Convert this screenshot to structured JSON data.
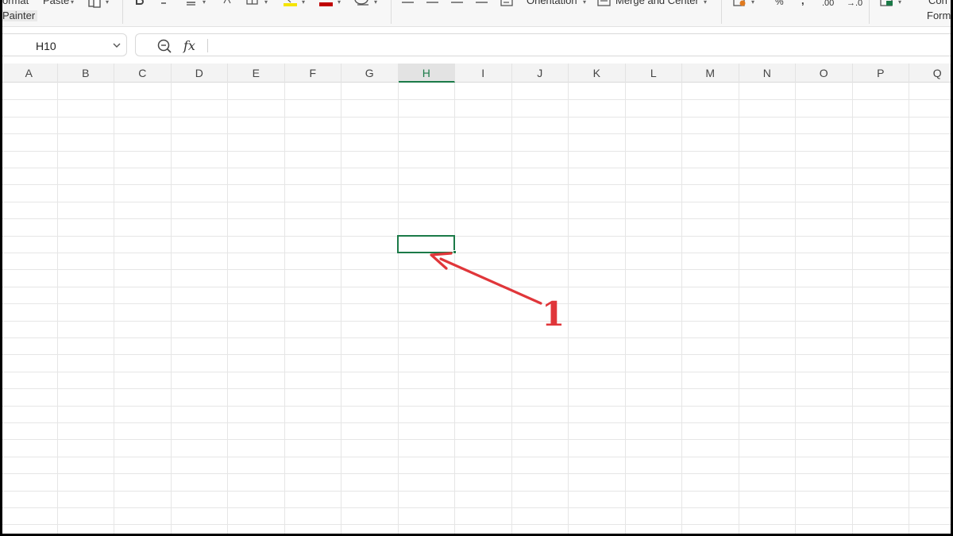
{
  "ribbon": {
    "format_painter_line1": "ormat",
    "format_painter_line2": "Painter",
    "paste_label": "Paste",
    "orientation_label": "Orientation",
    "merge_center_label": "Merge and Center",
    "percent_label": "%",
    "comma_label": ",",
    "inc_decimal_label": ".00",
    "dec_decimal_label": "→.0",
    "cond_format_line1": "Con",
    "cond_format_line2": "Form"
  },
  "formula_bar": {
    "name_box_value": "H10",
    "fx_label": "fx",
    "formula_value": ""
  },
  "columns": [
    "A",
    "B",
    "C",
    "D",
    "E",
    "F",
    "G",
    "H",
    "I",
    "J",
    "K",
    "L",
    "M",
    "N",
    "O",
    "P",
    "Q"
  ],
  "selected_column": "H",
  "active_cell": "H10",
  "annotation": {
    "number": "1",
    "color": "#e0363a"
  },
  "colors": {
    "accent": "#1b7a48",
    "highlight_yellow": "#f5e400",
    "font_red": "#c00000"
  }
}
